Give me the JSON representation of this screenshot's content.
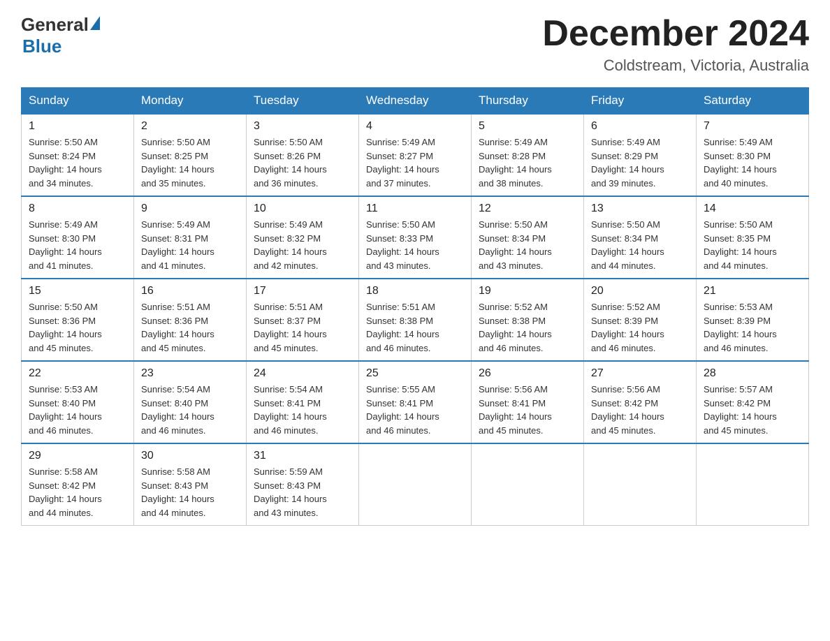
{
  "logo": {
    "general": "General",
    "blue": "Blue"
  },
  "title": {
    "month": "December 2024",
    "location": "Coldstream, Victoria, Australia"
  },
  "days_of_week": [
    "Sunday",
    "Monday",
    "Tuesday",
    "Wednesday",
    "Thursday",
    "Friday",
    "Saturday"
  ],
  "weeks": [
    [
      {
        "day": "1",
        "sunrise": "5:50 AM",
        "sunset": "8:24 PM",
        "daylight": "14 hours and 34 minutes."
      },
      {
        "day": "2",
        "sunrise": "5:50 AM",
        "sunset": "8:25 PM",
        "daylight": "14 hours and 35 minutes."
      },
      {
        "day": "3",
        "sunrise": "5:50 AM",
        "sunset": "8:26 PM",
        "daylight": "14 hours and 36 minutes."
      },
      {
        "day": "4",
        "sunrise": "5:49 AM",
        "sunset": "8:27 PM",
        "daylight": "14 hours and 37 minutes."
      },
      {
        "day": "5",
        "sunrise": "5:49 AM",
        "sunset": "8:28 PM",
        "daylight": "14 hours and 38 minutes."
      },
      {
        "day": "6",
        "sunrise": "5:49 AM",
        "sunset": "8:29 PM",
        "daylight": "14 hours and 39 minutes."
      },
      {
        "day": "7",
        "sunrise": "5:49 AM",
        "sunset": "8:30 PM",
        "daylight": "14 hours and 40 minutes."
      }
    ],
    [
      {
        "day": "8",
        "sunrise": "5:49 AM",
        "sunset": "8:30 PM",
        "daylight": "14 hours and 41 minutes."
      },
      {
        "day": "9",
        "sunrise": "5:49 AM",
        "sunset": "8:31 PM",
        "daylight": "14 hours and 41 minutes."
      },
      {
        "day": "10",
        "sunrise": "5:49 AM",
        "sunset": "8:32 PM",
        "daylight": "14 hours and 42 minutes."
      },
      {
        "day": "11",
        "sunrise": "5:50 AM",
        "sunset": "8:33 PM",
        "daylight": "14 hours and 43 minutes."
      },
      {
        "day": "12",
        "sunrise": "5:50 AM",
        "sunset": "8:34 PM",
        "daylight": "14 hours and 43 minutes."
      },
      {
        "day": "13",
        "sunrise": "5:50 AM",
        "sunset": "8:34 PM",
        "daylight": "14 hours and 44 minutes."
      },
      {
        "day": "14",
        "sunrise": "5:50 AM",
        "sunset": "8:35 PM",
        "daylight": "14 hours and 44 minutes."
      }
    ],
    [
      {
        "day": "15",
        "sunrise": "5:50 AM",
        "sunset": "8:36 PM",
        "daylight": "14 hours and 45 minutes."
      },
      {
        "day": "16",
        "sunrise": "5:51 AM",
        "sunset": "8:36 PM",
        "daylight": "14 hours and 45 minutes."
      },
      {
        "day": "17",
        "sunrise": "5:51 AM",
        "sunset": "8:37 PM",
        "daylight": "14 hours and 45 minutes."
      },
      {
        "day": "18",
        "sunrise": "5:51 AM",
        "sunset": "8:38 PM",
        "daylight": "14 hours and 46 minutes."
      },
      {
        "day": "19",
        "sunrise": "5:52 AM",
        "sunset": "8:38 PM",
        "daylight": "14 hours and 46 minutes."
      },
      {
        "day": "20",
        "sunrise": "5:52 AM",
        "sunset": "8:39 PM",
        "daylight": "14 hours and 46 minutes."
      },
      {
        "day": "21",
        "sunrise": "5:53 AM",
        "sunset": "8:39 PM",
        "daylight": "14 hours and 46 minutes."
      }
    ],
    [
      {
        "day": "22",
        "sunrise": "5:53 AM",
        "sunset": "8:40 PM",
        "daylight": "14 hours and 46 minutes."
      },
      {
        "day": "23",
        "sunrise": "5:54 AM",
        "sunset": "8:40 PM",
        "daylight": "14 hours and 46 minutes."
      },
      {
        "day": "24",
        "sunrise": "5:54 AM",
        "sunset": "8:41 PM",
        "daylight": "14 hours and 46 minutes."
      },
      {
        "day": "25",
        "sunrise": "5:55 AM",
        "sunset": "8:41 PM",
        "daylight": "14 hours and 46 minutes."
      },
      {
        "day": "26",
        "sunrise": "5:56 AM",
        "sunset": "8:41 PM",
        "daylight": "14 hours and 45 minutes."
      },
      {
        "day": "27",
        "sunrise": "5:56 AM",
        "sunset": "8:42 PM",
        "daylight": "14 hours and 45 minutes."
      },
      {
        "day": "28",
        "sunrise": "5:57 AM",
        "sunset": "8:42 PM",
        "daylight": "14 hours and 45 minutes."
      }
    ],
    [
      {
        "day": "29",
        "sunrise": "5:58 AM",
        "sunset": "8:42 PM",
        "daylight": "14 hours and 44 minutes."
      },
      {
        "day": "30",
        "sunrise": "5:58 AM",
        "sunset": "8:43 PM",
        "daylight": "14 hours and 44 minutes."
      },
      {
        "day": "31",
        "sunrise": "5:59 AM",
        "sunset": "8:43 PM",
        "daylight": "14 hours and 43 minutes."
      },
      null,
      null,
      null,
      null
    ]
  ],
  "labels": {
    "sunrise": "Sunrise:",
    "sunset": "Sunset:",
    "daylight": "Daylight:"
  }
}
